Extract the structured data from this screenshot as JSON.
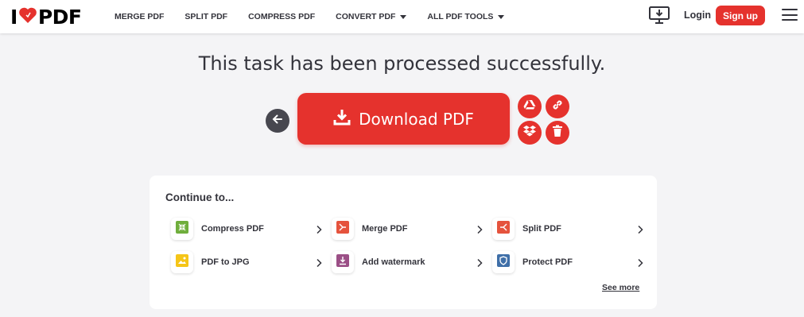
{
  "header": {
    "logo_left": "I",
    "logo_right": "PDF",
    "nav": [
      {
        "label": "MERGE PDF",
        "dropdown": false
      },
      {
        "label": "SPLIT PDF",
        "dropdown": false
      },
      {
        "label": "COMPRESS PDF",
        "dropdown": false
      },
      {
        "label": "CONVERT PDF",
        "dropdown": true
      },
      {
        "label": "ALL PDF TOOLS",
        "dropdown": true
      }
    ],
    "login": "Login",
    "signup": "Sign up"
  },
  "main": {
    "title": "This task has been processed successfully.",
    "download_label": "Download PDF",
    "actions": [
      "google-drive-icon",
      "link-icon",
      "dropbox-icon",
      "trash-icon"
    ]
  },
  "continue": {
    "title": "Continue to...",
    "tools": [
      {
        "name": "Compress PDF",
        "icon": "compress-icon",
        "color": "#6fae3c"
      },
      {
        "name": "Merge PDF",
        "icon": "merge-icon",
        "color": "#e5533d"
      },
      {
        "name": "Split PDF",
        "icon": "split-icon",
        "color": "#e5533d"
      },
      {
        "name": "PDF to JPG",
        "icon": "jpg-icon",
        "color": "#f5c518"
      },
      {
        "name": "Add watermark",
        "icon": "watermark-icon",
        "color": "#9b4f86"
      },
      {
        "name": "Protect PDF",
        "icon": "shield-icon",
        "color": "#3f6fa8"
      }
    ],
    "see_more": "See more"
  },
  "colors": {
    "accent": "#e5322d",
    "text": "#33333b",
    "background": "#f4f4f6"
  }
}
